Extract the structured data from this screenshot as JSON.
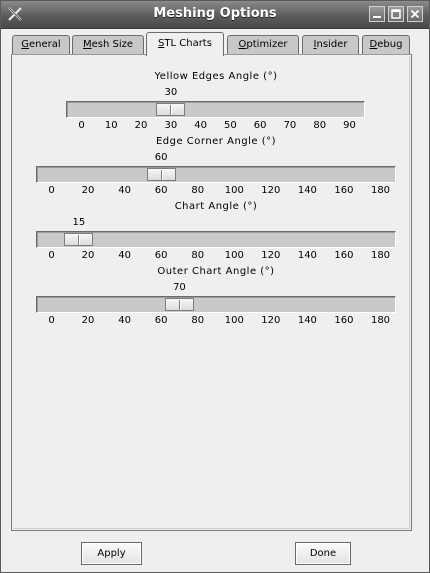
{
  "window": {
    "title": "Meshing Options"
  },
  "tabs": [
    {
      "label": "General",
      "ul": "G",
      "rest": "eneral"
    },
    {
      "label": "Mesh Size",
      "ul": "M",
      "rest": "esh Size"
    },
    {
      "label": "STL Charts",
      "ul": "S",
      "rest": "TL Charts"
    },
    {
      "label": "Optimizer",
      "ul": "O",
      "rest": "ptimizer"
    },
    {
      "label": "Insider",
      "ul": "I",
      "rest": "nsider"
    },
    {
      "label": "Debug",
      "ul": "D",
      "rest": "ebug"
    }
  ],
  "active_tab": "STL Charts",
  "sliders": [
    {
      "label": "Yellow Edges Angle (°)",
      "value": "30",
      "min": 0,
      "max": 90,
      "ticks": [
        "0",
        "10",
        "20",
        "30",
        "40",
        "50",
        "60",
        "70",
        "80",
        "90"
      ]
    },
    {
      "label": "Edge Corner Angle (°)",
      "value": "60",
      "min": 0,
      "max": 180,
      "ticks": [
        "0",
        "20",
        "40",
        "60",
        "80",
        "100",
        "120",
        "140",
        "160",
        "180"
      ]
    },
    {
      "label": "Chart Angle (°)",
      "value": "15",
      "min": 0,
      "max": 180,
      "ticks": [
        "0",
        "20",
        "40",
        "60",
        "80",
        "100",
        "120",
        "140",
        "160",
        "180"
      ]
    },
    {
      "label": "Outer Chart Angle (°)",
      "value": "70",
      "min": 0,
      "max": 180,
      "ticks": [
        "0",
        "20",
        "40",
        "60",
        "80",
        "100",
        "120",
        "140",
        "160",
        "180"
      ]
    }
  ],
  "buttons": {
    "apply": "Apply",
    "done": "Done"
  },
  "icons": {
    "app": "x-logo-icon",
    "minimize": "minimize-icon",
    "maximize": "maximize-icon",
    "close": "close-icon"
  }
}
